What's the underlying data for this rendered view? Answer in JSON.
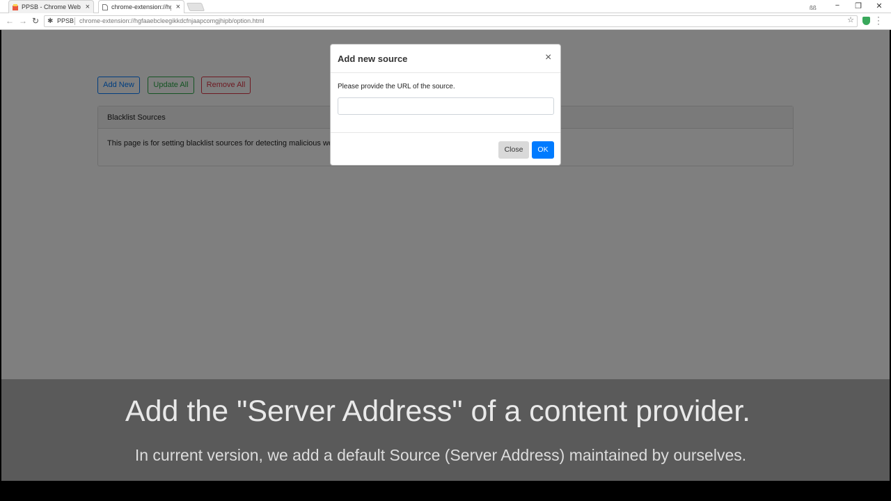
{
  "browser": {
    "tabs": [
      {
        "title": "PPSB - Chrome Web Sto",
        "close": "×",
        "favicon": "chrome-web-store-icon"
      },
      {
        "title": "chrome-extension://hgfa",
        "close": "×",
        "favicon": "page-icon"
      }
    ],
    "window_controls": {
      "minimize": "−",
      "restore": "❐",
      "close": "✕"
    },
    "omnibox": {
      "chip": "PPSB",
      "url": "chrome-extension://hgfaaebcleegikkdcfnjaapcomgjhipb/option.html"
    },
    "nav": {
      "back": "←",
      "forward": "→",
      "reload": "↻"
    }
  },
  "page": {
    "buttons": {
      "add_new": "Add New",
      "update_all": "Update All",
      "remove_all": "Remove All"
    },
    "card": {
      "header": "Blacklist Sources",
      "body": "This page is for setting blacklist sources for detecting malicious web"
    }
  },
  "modal": {
    "title": "Add new source",
    "close_x": "×",
    "prompt": "Please provide the URL of the source.",
    "input_value": "",
    "close_button": "Close",
    "ok_button": "OK"
  },
  "caption": {
    "title": "Add the \"Server Address\" of a content provider.",
    "subtitle": "In current version, we add a default Source (Server Address) maintained by ourselves."
  },
  "colors": {
    "primary": "#007bff",
    "success": "#28a745",
    "danger": "#dc3545",
    "extension_shield": "#39a85b"
  }
}
